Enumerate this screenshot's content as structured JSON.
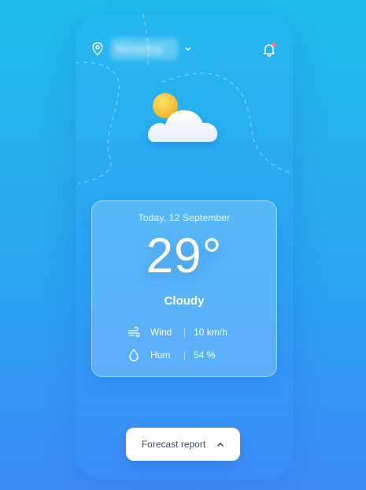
{
  "header": {
    "location": "Semarang",
    "has_notification": true
  },
  "weather": {
    "icon": "sun-behind-cloud-icon",
    "date": "Today, 12 September",
    "temperature": "29°",
    "condition": "Cloudy"
  },
  "stats": [
    {
      "icon": "wind-icon",
      "label": "Wind",
      "value": "10 km/h"
    },
    {
      "icon": "droplet-icon",
      "label": "Hum",
      "value": "54 %"
    }
  ],
  "stat_separator": "|",
  "footer": {
    "forecast_label": "Forecast report"
  },
  "colors": {
    "background_top": "#1ebde8",
    "background_bottom": "#3d8cf5",
    "sun": "#f7c22a",
    "notification_dot": "#ff7a59",
    "button_text": "#3b4a66"
  }
}
